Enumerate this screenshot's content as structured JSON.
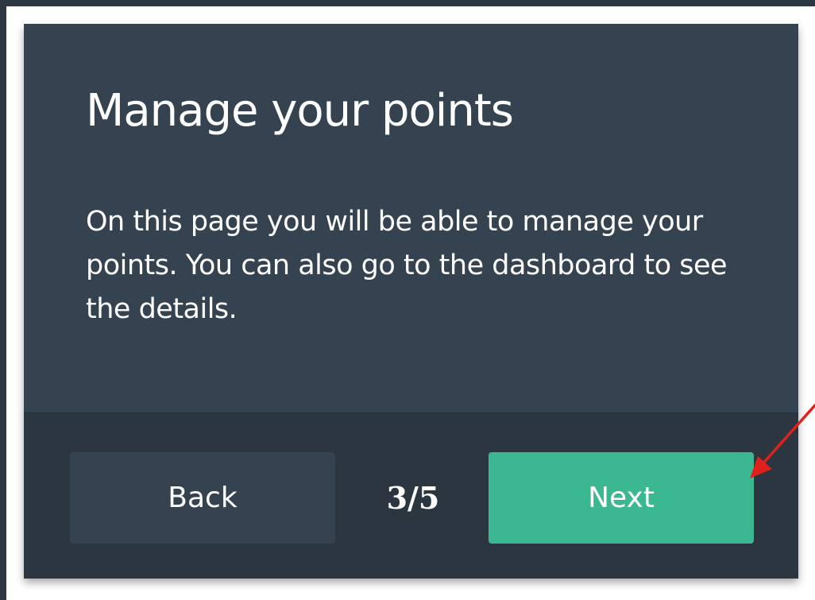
{
  "tour_step": {
    "title": "Manage your points",
    "description": "On this page you will be able to manage your points. You can also go to the dashboard to see the details.",
    "back_label": "Back",
    "counter": "3/5",
    "next_label": "Next",
    "current_step": 3,
    "total_steps": 5
  },
  "annotation": {
    "icon": "arrow-icon",
    "target": "next-button",
    "color": "#e0211b"
  },
  "colors": {
    "background": "#2b3843",
    "card": "#34434f",
    "footer": "#2b3640",
    "next_button": "#3bb792",
    "back_button": "#34434f",
    "text": "#ffffff"
  }
}
